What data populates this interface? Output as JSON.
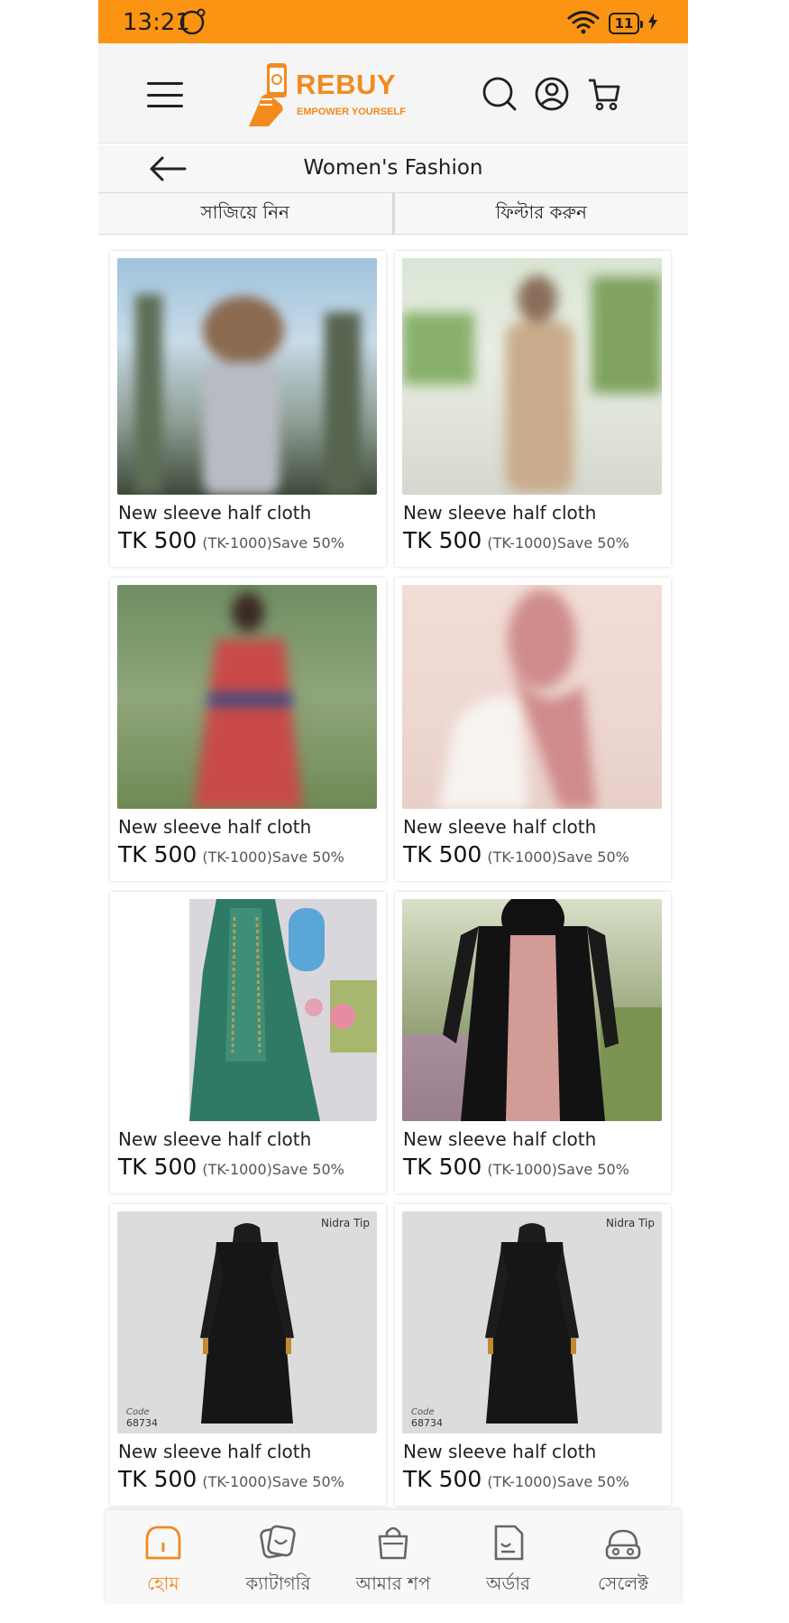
{
  "status_bar": {
    "time": "13:21",
    "battery": "11"
  },
  "header": {
    "brand": "REBUY",
    "tagline": "EMPOWER YOURSELF"
  },
  "subheader": {
    "title": "Women's Fashion",
    "sort_label": "সাজিয়ে নিন",
    "filter_label": "ফিল্টার করুন"
  },
  "products": [
    {
      "name": "New sleeve half cloth",
      "price": "TK 500",
      "original": "(TK-1000)",
      "save": "Save 50%",
      "image": "blurred woman in light dress"
    },
    {
      "name": "New sleeve half cloth",
      "price": "TK 500",
      "original": "(TK-1000)",
      "save": "Save 50%",
      "image": "blurred woman in beige outfit"
    },
    {
      "name": "New sleeve half cloth",
      "price": "TK 500",
      "original": "(TK-1000)",
      "save": "Save 50%",
      "image": "blurred woman in red dress"
    },
    {
      "name": "New sleeve half cloth",
      "price": "TK 500",
      "original": "(TK-1000)",
      "save": "Save 50%",
      "image": "blurred woman in pink hijab"
    },
    {
      "name": "New sleeve half cloth",
      "price": "TK 500",
      "original": "(TK-1000)",
      "save": "Save 50%",
      "image": "green embroidered gown"
    },
    {
      "name": "New sleeve half cloth",
      "price": "TK 500",
      "original": "(TK-1000)",
      "save": "Save 50%",
      "image": "black and pink abaya"
    },
    {
      "name": "New sleeve half cloth",
      "price": "TK 500",
      "original": "(TK-1000)",
      "save": "Save 50%",
      "image": "black abaya on mannequin",
      "brand_mark": "Nidra Tip",
      "code_label": "Code",
      "code": "68734"
    },
    {
      "name": "New sleeve half cloth",
      "price": "TK 500",
      "original": "(TK-1000)",
      "save": "Save 50%",
      "image": "black abaya on mannequin",
      "brand_mark": "Nidra Tip",
      "code_label": "Code",
      "code": "68734"
    }
  ],
  "bottom_nav": [
    {
      "label": "হোম",
      "icon": "home-icon",
      "active": true
    },
    {
      "label": "ক্যাটাগরি",
      "icon": "category-icon",
      "active": false
    },
    {
      "label": "আমার শপ",
      "icon": "shopping-bag-icon",
      "active": false
    },
    {
      "label": "অর্ডার",
      "icon": "order-document-icon",
      "active": false
    },
    {
      "label": "সেলেক্ট",
      "icon": "select-basket-icon",
      "active": false
    }
  ],
  "colors": {
    "accent": "#fb9412",
    "brand": "#f28a1e"
  }
}
